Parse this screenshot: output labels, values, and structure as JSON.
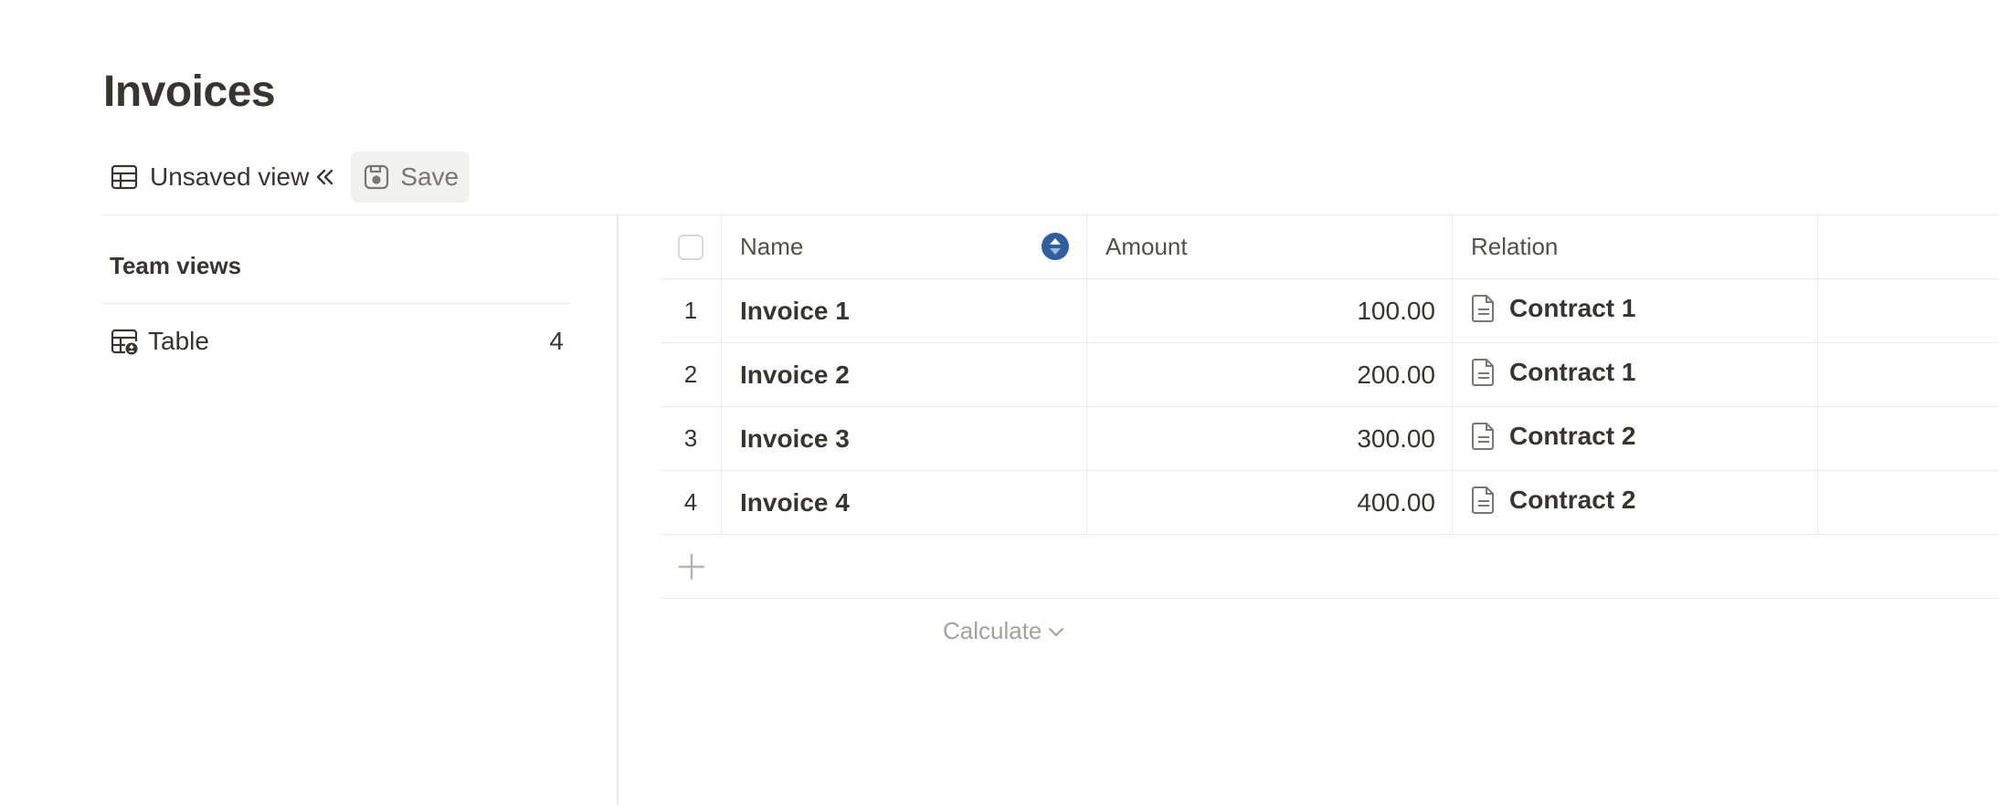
{
  "page": {
    "title": "Invoices"
  },
  "viewbar": {
    "current_view_label": "Unsaved view",
    "save_label": "Save"
  },
  "sidebar": {
    "section_title": "Team views",
    "items": [
      {
        "label": "Table",
        "count": "4"
      }
    ]
  },
  "table": {
    "columns": [
      "Name",
      "Amount",
      "Relation"
    ],
    "rows": [
      {
        "index": "1",
        "name": "Invoice 1",
        "amount": "100.00",
        "relation": "Contract 1"
      },
      {
        "index": "2",
        "name": "Invoice 2",
        "amount": "200.00",
        "relation": "Contract 1"
      },
      {
        "index": "3",
        "name": "Invoice 3",
        "amount": "300.00",
        "relation": "Contract 2"
      },
      {
        "index": "4",
        "name": "Invoice 4",
        "amount": "400.00",
        "relation": "Contract 2"
      }
    ],
    "calculate_label": "Calculate"
  },
  "colors": {
    "sort_indicator": "#2f5fa0",
    "text": "#37352f",
    "muted": "#a3a29e",
    "border": "#e9e9e7"
  }
}
